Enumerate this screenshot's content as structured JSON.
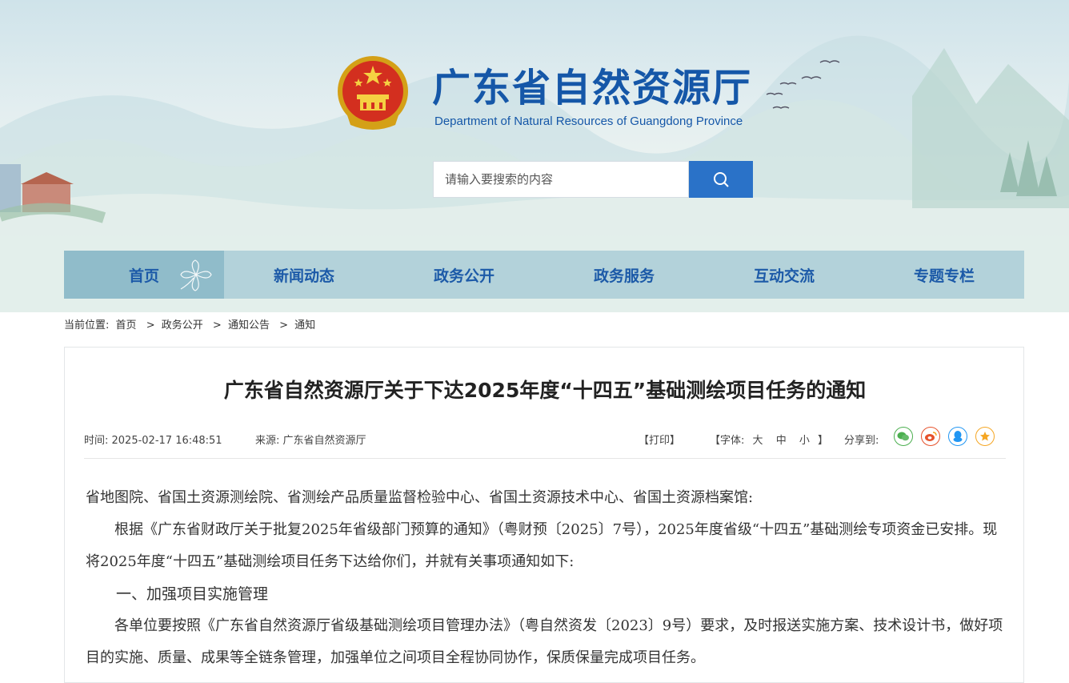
{
  "header": {
    "title": "广东省自然资源厅",
    "subtitle": "Department of Natural Resources of Guangdong Province",
    "search_placeholder": "请输入要搜索的内容"
  },
  "nav": {
    "items": [
      "首页",
      "新闻动态",
      "政务公开",
      "政务服务",
      "互动交流",
      "专题专栏"
    ],
    "active_index": 0
  },
  "breadcrumb": {
    "label": "当前位置:",
    "items": [
      "首页",
      "政务公开",
      "通知公告",
      "通知"
    ],
    "separator": ">"
  },
  "article": {
    "title": "广东省自然资源厅关于下达2025年度“十四五”基础测绘项目任务的通知",
    "time": "时间: 2025-02-17 16:48:51",
    "source": "来源: 广东省自然资源厅",
    "print": "【打印】",
    "font_label": "【字体:",
    "font_options": [
      "大",
      "中",
      "小"
    ],
    "font_close": "】",
    "share_label": "分享到:",
    "share_icons": [
      "wechat-icon",
      "weibo-icon",
      "qq-icon",
      "favorite-icon"
    ],
    "paragraphs": [
      "省地图院、省国土资源测绘院、省测绘产品质量监督检验中心、省国土资源技术中心、省国土资源档案馆:",
      "根据《广东省财政厅关于批复2025年省级部门预算的通知》（粤财预〔2025〕7号），2025年度省级“十四五”基础测绘专项资金已安排。现将2025年度“十四五”基础测绘项目任务下达给你们，并就有关事项通知如下:",
      "一、加强项目实施管理",
      "各单位要按照《广东省自然资源厅省级基础测绘项目管理办法》（粤自然资发〔2023〕9号）要求，及时报送实施方案、技术设计书，做好项目的实施、质量、成果等全链条管理，加强单位之间项目全程协同协作，保质保量完成项目任务。"
    ]
  },
  "colors": {
    "brand_blue": "#1557a8",
    "search_button": "#2a72c8",
    "nav_background": "#aacdd7"
  }
}
